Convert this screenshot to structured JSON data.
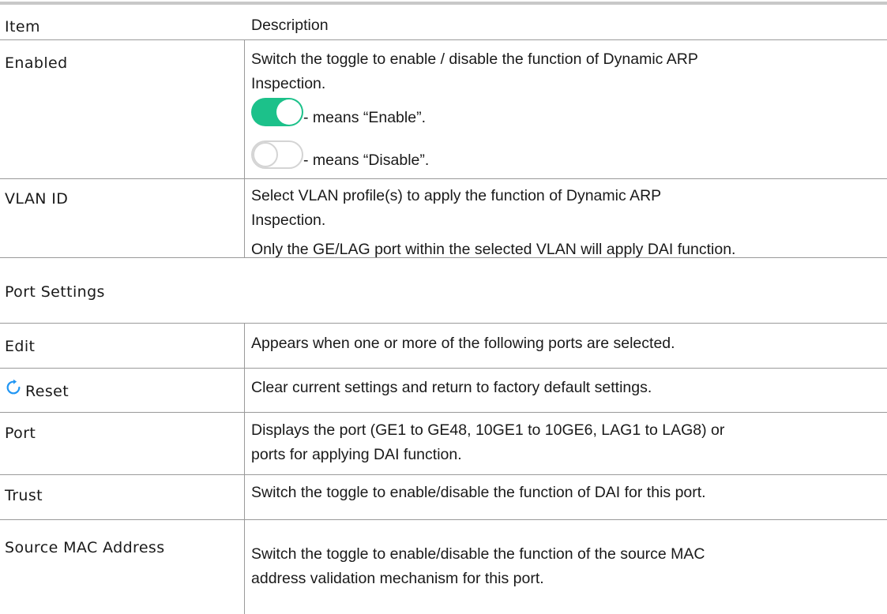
{
  "table": {
    "header": {
      "item": "Item",
      "description": "Description"
    },
    "enabled": {
      "item": "Enabled",
      "line1": "Switch the toggle to enable / disable the function of Dynamic ARP",
      "line2": "Inspection.",
      "on_text": "- means “Enable”.",
      "off_text": "- means “Disable”."
    },
    "vlan": {
      "item": "VLAN ID",
      "line1": "Select VLAN profile(s) to apply the function of Dynamic ARP",
      "line2": "Inspection.",
      "line3": "Only the GE/LAG port within the selected VLAN will apply DAI function."
    },
    "port_settings": {
      "label": "Port Settings"
    },
    "edit": {
      "item": "Edit",
      "description": "Appears when one or more of the following ports are selected."
    },
    "reset": {
      "item": "Reset",
      "icon": "refresh-icon",
      "description": "Clear current settings and return to factory default settings."
    },
    "port": {
      "item": "Port",
      "line1": "Displays the port (GE1 to GE48, 10GE1 to 10GE6, LAG1 to LAG8) or",
      "line2": "ports for applying DAI function."
    },
    "trust": {
      "item": "Trust",
      "description": "Switch the toggle to enable/disable the function of DAI for this port."
    },
    "source_mac": {
      "item": "Source MAC Address",
      "line1": "Switch the toggle to enable/disable the function of the source MAC",
      "line2": "address validation mechanism for this port."
    }
  },
  "colors": {
    "toggle_on": "#1cc18a",
    "toggle_off_border": "#d4d4d4",
    "reset_icon": "#2196f3",
    "rule": "#9a9a9a"
  }
}
